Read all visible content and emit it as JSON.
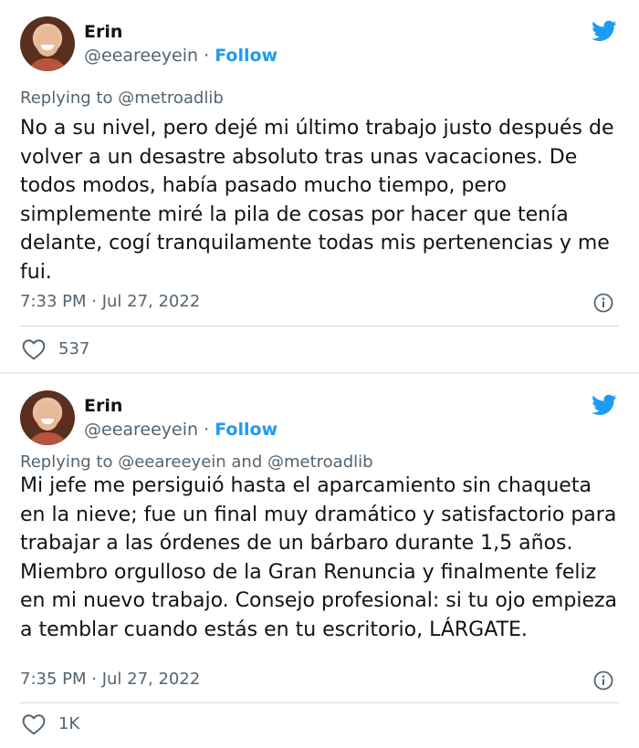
{
  "tweets": [
    {
      "author_name": "Erin",
      "handle": "@eeareeyein",
      "separator": " · ",
      "follow_label": "Follow",
      "reply_prefix": "Replying to",
      "reply_mentions": " @metroadlib",
      "text": "No a su nivel, pero dejé mi último trabajo justo después de volver a un desastre absoluto tras unas vacaciones. De todos modos, había pasado mucho tiempo, pero simplemente miré la pila de cosas por hacer que tenía delante, cogí tranquilamente todas mis pertenencias y me fui.",
      "timestamp": "7:33 PM · Jul 27, 2022",
      "likes": "537"
    },
    {
      "author_name": "Erin",
      "handle": "@eeareeyein",
      "separator": " · ",
      "follow_label": "Follow",
      "reply_prefix": "Replying to",
      "reply_mentions": " @eeareeyein and @metroadlib",
      "text": "Mi jefe me persiguió hasta el aparcamiento sin chaqueta en la nieve; fue un final muy dramático y satisfactorio para trabajar a las órdenes de un bárbaro durante 1,5 años. Miembro orgulloso de la Gran Renuncia y finalmente feliz en mi nuevo trabajo. Consejo profesional: si tu ojo empieza a temblar cuando estás en tu escritorio, LÁRGATE.",
      "timestamp": "7:35 PM · Jul 27, 2022",
      "likes": "1K"
    }
  ],
  "colors": {
    "accent": "#1d9bf0",
    "muted": "#536471",
    "text": "#0f1419",
    "background": "#e6ecf0"
  },
  "icons": [
    "twitter-bird-icon",
    "info-icon",
    "heart-icon"
  ]
}
